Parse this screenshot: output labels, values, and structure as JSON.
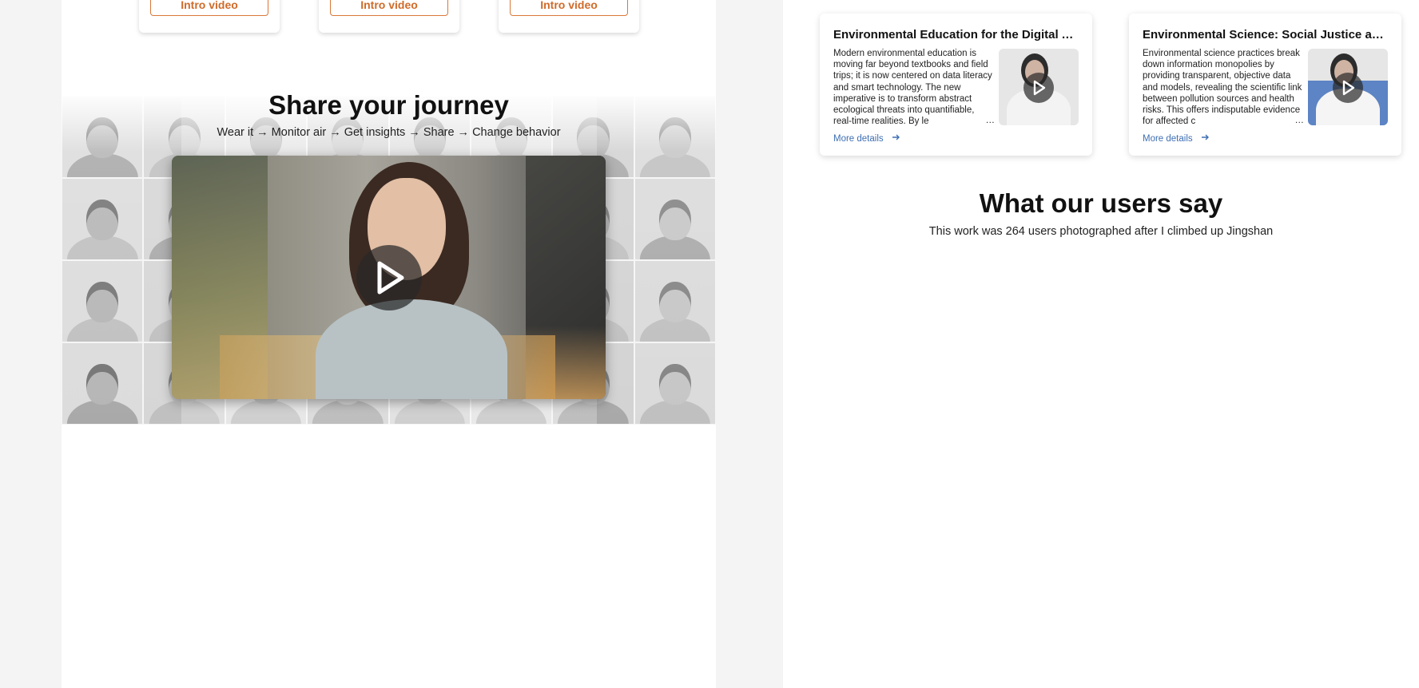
{
  "intro_cards": [
    {
      "button_label": "Intro video"
    },
    {
      "button_label": "Intro video"
    },
    {
      "button_label": "Intro video"
    }
  ],
  "journey": {
    "title": "Share your journey",
    "steps": "Wear it → Monitor air → Get insights → Share → Change behavior"
  },
  "courses": [
    {
      "title": "Environmental Education for the Digital Age",
      "description": "Modern environmental education is moving far beyond textbooks and field trips; it is now centered on data literacy and smart technology. The new imperative is to transform abstract ecological threats into quantifiable, real-time realities. By le",
      "link": "More details"
    },
    {
      "title": "Environmental Science:  Social Justice and...",
      "description": "Environmental science practices break down information monopolies by providing transparent, objective data and models, revealing the scientific link between pollution sources and health risks. This offers indisputable evidence for affected c",
      "link": "More details"
    }
  ],
  "testimonials": {
    "title": "What our users say",
    "subtitle": "This work was 264 users photographed after I climbed up Jingshan"
  },
  "colors": {
    "accent_orange": "#d9783a",
    "link_blue": "#3e6fb3",
    "page_bg": "#f4f4f4"
  }
}
